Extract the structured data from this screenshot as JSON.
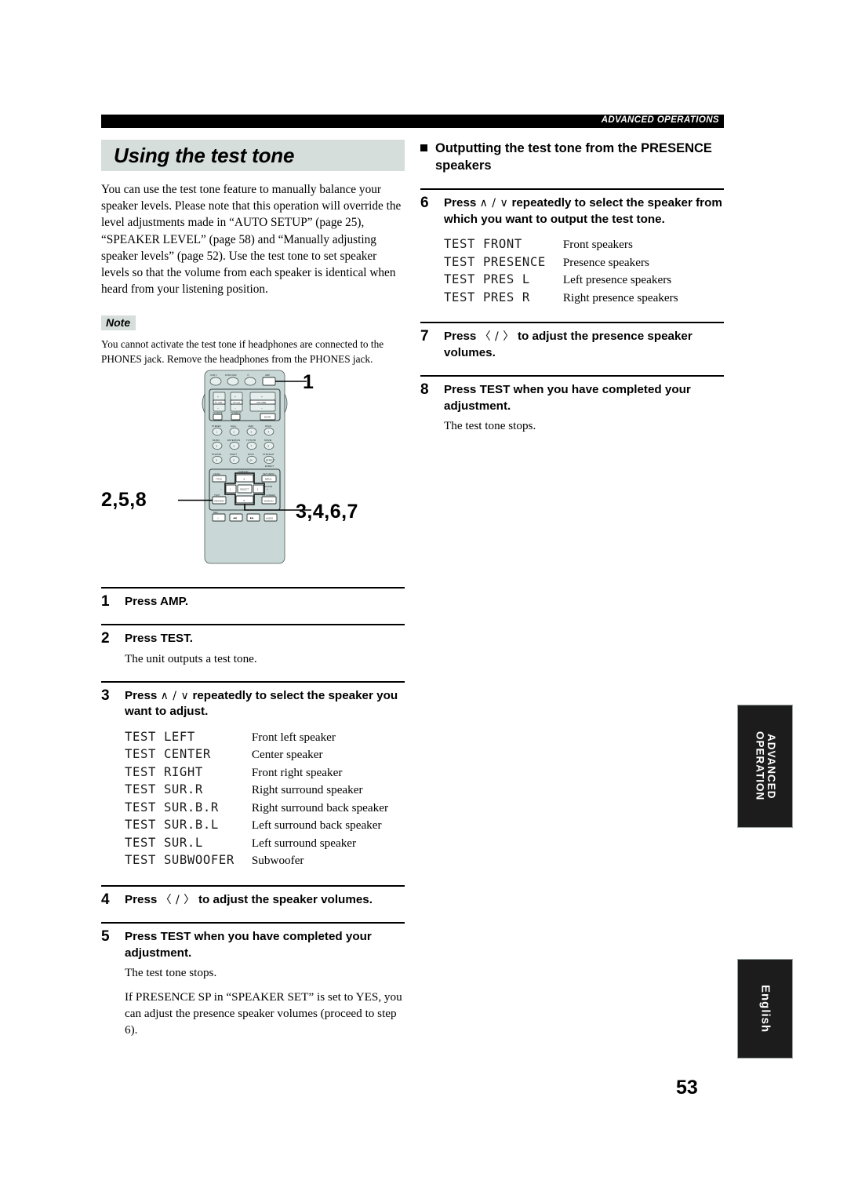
{
  "header": {
    "running_head": "ADVANCED OPERATIONS"
  },
  "left_column": {
    "section_title": "Using the test tone",
    "intro": "You can use the test tone feature to manually balance your speaker levels. Please note that this operation will override the level adjustments made in “AUTO SETUP” (page 25), “SPEAKER LEVEL” (page 58) and “Manually adjusting speaker levels” (page 52). Use the test tone to set speaker levels so that the volume from each speaker is identical when heard from your listening position.",
    "note_label": "Note",
    "note_text": "You cannot activate the test tone if headphones are connected to the PHONES jack. Remove the headphones from the PHONES jack.",
    "steps": [
      {
        "num": "1",
        "head": "Press AMP.",
        "subs": []
      },
      {
        "num": "2",
        "head": "Press TEST.",
        "subs": [
          "The unit outputs a test tone."
        ]
      },
      {
        "num": "3",
        "head_pre": "Press ",
        "head_arrows": "∧ / ∨",
        "head_post": " repeatedly to select the speaker you want to adjust.",
        "subs": []
      },
      {
        "num": "4",
        "head_pre": "Press ",
        "head_arrows": "〈 / 〉",
        "head_post": " to adjust the speaker volumes.",
        "subs": []
      },
      {
        "num": "5",
        "head": "Press TEST when you have completed your adjustment.",
        "subs": [
          "The test tone stops.",
          "If PRESENCE SP in “SPEAKER SET” is set to YES, you can adjust the presence speaker volumes (proceed to step 6)."
        ]
      }
    ],
    "lcd_rows": [
      {
        "code": "TEST LEFT",
        "desc": "Front left speaker"
      },
      {
        "code": "TEST CENTER",
        "desc": "Center speaker"
      },
      {
        "code": "TEST RIGHT",
        "desc": "Front right speaker"
      },
      {
        "code": "TEST SUR.R",
        "desc": "Right surround speaker"
      },
      {
        "code": "TEST SUR.B.R",
        "desc": "Right surround back speaker"
      },
      {
        "code": "TEST SUR.B.L",
        "desc": "Left surround back speaker"
      },
      {
        "code": "TEST SUR.L",
        "desc": "Left surround speaker"
      },
      {
        "code": "TEST SUBWOOFER",
        "desc": "Subwoofer"
      }
    ]
  },
  "right_column": {
    "subsection_title": "Outputting the test tone from the PRESENCE speakers",
    "steps": [
      {
        "num": "6",
        "head_pre": "Press ",
        "head_arrows": "∧ / ∨",
        "head_post": " repeatedly to select the speaker from which you want to output the test tone.",
        "subs": []
      },
      {
        "num": "7",
        "head_pre": "Press ",
        "head_arrows": "〈 / 〉",
        "head_post": " to adjust the presence speaker volumes.",
        "subs": []
      },
      {
        "num": "8",
        "head": "Press TEST when you have completed your adjustment.",
        "subs": [
          "The test tone stops."
        ]
      }
    ],
    "lcd_rows": [
      {
        "code": "TEST FRONT",
        "desc": "Front speakers"
      },
      {
        "code": "TEST PRESENCE",
        "desc": "Presence speakers"
      },
      {
        "code": "TEST PRES L",
        "desc": "Left presence speakers"
      },
      {
        "code": "TEST PRES R",
        "desc": "Right presence speakers"
      }
    ]
  },
  "figure": {
    "callouts": {
      "top_right": "1",
      "left": "2,5,8",
      "bottom_right": "3,4,6,7"
    },
    "remote": {
      "source_row": [
        "VCR 1",
        "DVR/VCR2",
        "⏻",
        "AMP"
      ],
      "tv_vol_label": "TV VOL",
      "tv_ch_label": "TV CH",
      "volume_label": "VOLUME",
      "tv_mute_label": "TV MUTE",
      "tv_input_label": "TV INPUT",
      "mute_label": "MUTE",
      "program_buttons": [
        {
          "top": "STEREO",
          "num": "1"
        },
        {
          "top": "HALL",
          "num": "2"
        },
        {
          "top": "JAZZ",
          "num": "3"
        },
        {
          "top": "ROCK",
          "num": "4"
        },
        {
          "top": "MUSIC",
          "num": "5"
        },
        {
          "top": "ENTERTAIN",
          "num": "6"
        },
        {
          "top": "TV/THTR",
          "num": "7"
        },
        {
          "top": "MOVIE",
          "num": "8"
        },
        {
          "top": "5CH/STE",
          "num": "9"
        },
        {
          "top": "NIGHT",
          "num": "0"
        },
        {
          "top": "EXTD",
          "num": "+10"
        },
        {
          "top": "STRAIGHT",
          "num": "EFFECT"
        }
      ],
      "effect_label": "EFFECT",
      "cursor_area": {
        "level_label": "LEVEL",
        "title_label": "TITLE",
        "set_menu_label": "SET MENU",
        "menu_label": "MENU",
        "a_bcde_label": "A/B/C/D/E",
        "up_label": "∧",
        "down_label": "∨",
        "left_label": "〈",
        "right_label": "〉",
        "select_label": "SELECT",
        "test_label": "TEST",
        "return_label": "RETURN",
        "on_screen_label": "ON SCREEN",
        "display_label": "DISPLAY",
        "minus": "−",
        "plus": "+"
      },
      "bottom_row": [
        {
          "top": "REC",
          "label": "○"
        },
        {
          "top": "",
          "label": "◀◀"
        },
        {
          "top": "",
          "label": "▶▶"
        },
        {
          "top": "",
          "label": "AUDIO"
        }
      ]
    }
  },
  "tabs": {
    "advanced": "ADVANCED\nOPERATION",
    "advanced_line1": "ADVANCED",
    "advanced_line2": "OPERATION",
    "english": "English"
  },
  "page_number": "53",
  "colors": {
    "shade": "#d6dedc",
    "remote_body": "#c9d8d6",
    "remote_key": "#e4eeec",
    "bar": "#000000"
  }
}
